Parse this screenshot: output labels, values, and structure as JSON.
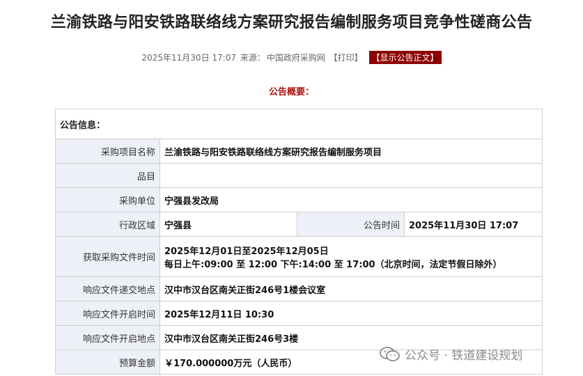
{
  "page": {
    "title": "兰渝铁路与阳安铁路联络线方案研究报告编制服务项目竞争性磋商公告",
    "meta": {
      "datetime": "2025年11月30日 17:07",
      "source_label": "来源：",
      "source": "中国政府采购网",
      "print": "【打印】",
      "show_full": "【显示公告正文】"
    },
    "overview_label": "公告概要："
  },
  "table": {
    "header": "公告信息：",
    "rows": {
      "project_name": {
        "label": "采购项目名称",
        "value": "兰渝铁路与阳安铁路联络线方案研究报告编制服务项目"
      },
      "item": {
        "label": "品目",
        "value": ""
      },
      "purchaser": {
        "label": "采购单位",
        "value": "宁强县发改局"
      },
      "region": {
        "label": "行政区域",
        "value": "宁强县",
        "label2": "公告时间",
        "value2": "2025年11月30日 17:07"
      },
      "doc_time": {
        "label": "获取采购文件时间",
        "value": "2025年12月01日至2025年12月05日",
        "value_line2": "每日上午:09:00 至 12:00  下午:14:00 至 17:00（北京时间，法定节假日除外）"
      },
      "submit_place": {
        "label": "响应文件递交地点",
        "value": "汉中市汉台区南关正街246号1楼会议室"
      },
      "open_time": {
        "label": "响应文件开启时间",
        "value": "2025年12月11日 10:30"
      },
      "open_place": {
        "label": "响应文件开启地点",
        "value": "汉中市汉台区南关正街246号3楼"
      },
      "budget": {
        "label": "预算金额",
        "value": "￥170.000000万元（人民币）"
      }
    }
  },
  "watermark": {
    "text": "公众号 · 铁道建设规划",
    "icon": "wechat-icon"
  }
}
